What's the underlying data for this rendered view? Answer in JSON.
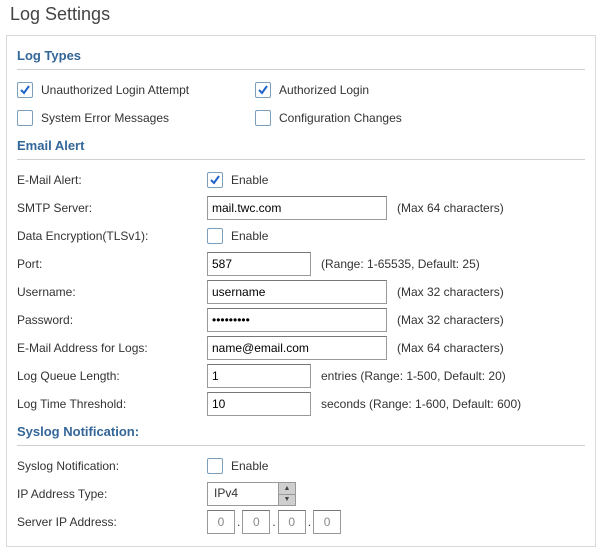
{
  "title": "Log Settings",
  "sections": {
    "types_header": "Log Types",
    "email_header": "Email Alert",
    "syslog_header": "Syslog Notification:"
  },
  "log_types": {
    "unauth": {
      "label": "Unauthorized Login Attempt",
      "checked": true
    },
    "auth": {
      "label": "Authorized Login",
      "checked": true
    },
    "syserr": {
      "label": "System Error Messages",
      "checked": false
    },
    "confchg": {
      "label": "Configuration Changes",
      "checked": false
    }
  },
  "email": {
    "alert_label": "E-Mail Alert:",
    "alert_enable_label": "Enable",
    "alert_checked": true,
    "smtp_label": "SMTP Server:",
    "smtp_value": "mail.twc.com",
    "smtp_hint": "(Max 64 characters)",
    "tls_label": "Data Encryption(TLSv1):",
    "tls_enable_label": "Enable",
    "tls_checked": false,
    "port_label": "Port:",
    "port_value": "587",
    "port_hint": "(Range: 1-65535, Default: 25)",
    "user_label": "Username:",
    "user_value": "username",
    "user_hint": "(Max 32 characters)",
    "pass_label": "Password:",
    "pass_value": "•••••••••",
    "pass_hint": "(Max 32 characters)",
    "addr_label": "E-Mail Address for Logs:",
    "addr_value": "name@email.com",
    "addr_hint": "(Max 64 characters)",
    "queue_label": "Log Queue Length:",
    "queue_value": "1",
    "queue_hint": "entries (Range: 1-500, Default: 20)",
    "thresh_label": "Log Time Threshold:",
    "thresh_value": "10",
    "thresh_hint": "seconds (Range: 1-600, Default: 600)"
  },
  "syslog": {
    "notif_label": "Syslog Notification:",
    "notif_enable_label": "Enable",
    "notif_checked": false,
    "ip_type_label": "IP Address Type:",
    "ip_type_value": "IPv4",
    "ip_addr_label": "Server IP Address:",
    "ip": {
      "a": "0",
      "b": "0",
      "c": "0",
      "d": "0"
    }
  }
}
